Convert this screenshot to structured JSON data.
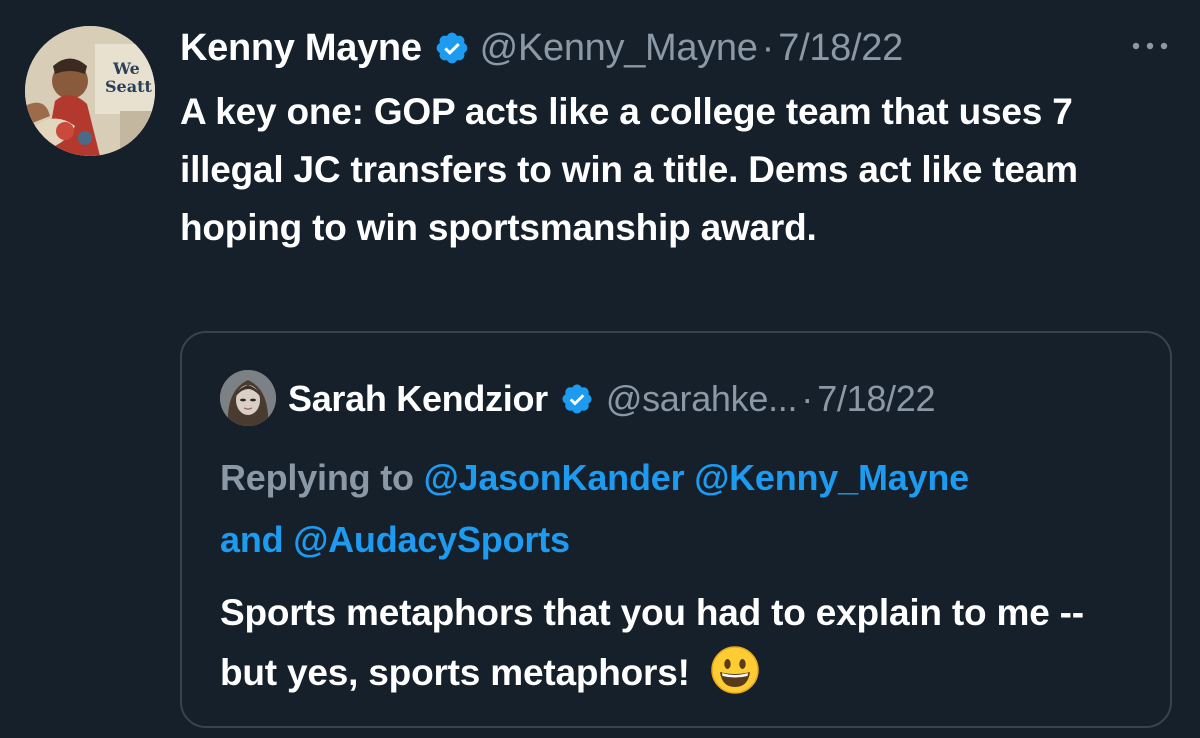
{
  "tweet": {
    "author_name": "Kenny Mayne",
    "author_handle": "@Kenny_Mayne",
    "separator": "·",
    "date": "7/18/22",
    "more_icon": "more-horizontal-icon",
    "text": "A key one: GOP acts like a college team that uses 7 illegal JC transfers to win a title. Dems act like team hoping to win sportsmanship award."
  },
  "quoted_tweet": {
    "author_name": "Sarah Kendzior",
    "author_handle": "@sarahke...",
    "separator": "·",
    "date": "7/18/22",
    "replying_prefix": "Replying to",
    "mention_1": "@JasonKander",
    "mention_2": "@Kenny_Mayne",
    "and_text": "and",
    "mention_3": "@AudacySports",
    "text": "Sports metaphors that you had to explain to me -- but yes, sports metaphors!",
    "emoji": "grinning-face-icon"
  },
  "colors": {
    "background": "#15202b",
    "primary_text": "#ffffff",
    "secondary_text": "#8b98a5",
    "accent": "#1d9bf0",
    "border": "#38444d"
  }
}
